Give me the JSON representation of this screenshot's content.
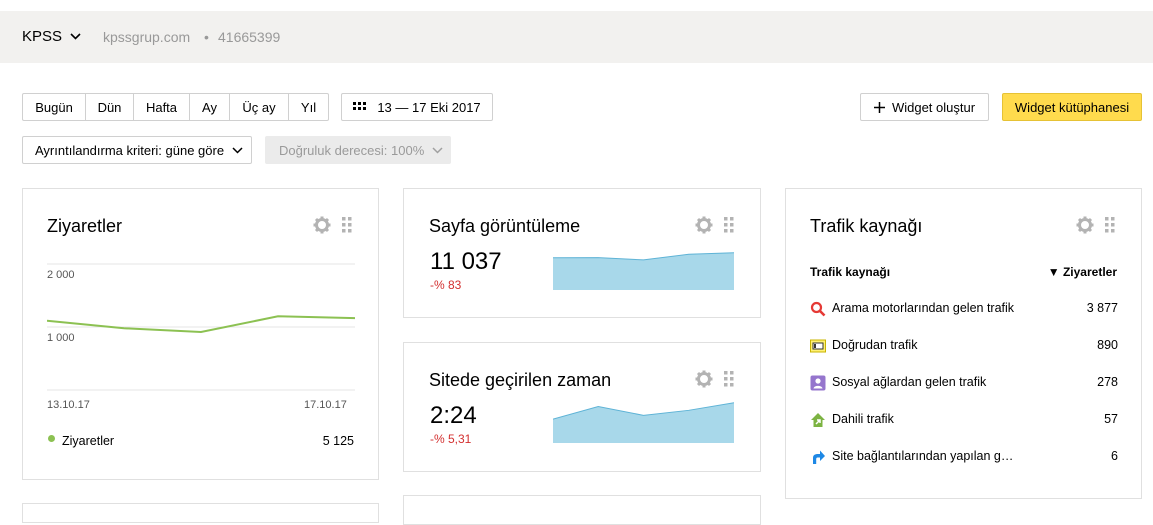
{
  "topbar": {
    "site_name": "KPSS",
    "host": "kpssgrup.com",
    "separator": "•",
    "counter_id": "41665399"
  },
  "period_buttons": [
    "Bugün",
    "Dün",
    "Hafta",
    "Ay",
    "Üç ay",
    "Yıl"
  ],
  "date_range": "13 — 17 Eki 2017",
  "create_widget_label": "Widget oluştur",
  "widget_library_label": "Widget kütüphanesi",
  "detail_select_label": "Ayrıntılandırma kriteri: güne göre",
  "accuracy_select_label": "Doğruluk derecesi: 100%",
  "colors": {
    "accent_yellow": "#ffdb4d",
    "line_green": "#8cc152",
    "area_blue": "#a8d8ea",
    "negative_red": "#d32f2f"
  },
  "visits_widget": {
    "title": "Ziyaretler",
    "y_ticks": [
      "2 000",
      "1 000"
    ],
    "x_ticks": [
      "13.10.17",
      "17.10.17"
    ],
    "legend_label": "Ziyaretler",
    "legend_value": "5 125",
    "chart_data": {
      "type": "line",
      "x": [
        "13.10.17",
        "14.10.17",
        "15.10.17",
        "16.10.17",
        "17.10.17"
      ],
      "series": [
        {
          "name": "Ziyaretler",
          "values": [
            1100,
            980,
            920,
            1170,
            1140
          ]
        }
      ],
      "ylim": [
        0,
        2000
      ]
    }
  },
  "pageviews_widget": {
    "title": "Sayfa görüntüleme",
    "value": "11 037",
    "delta": "-% 83",
    "sparkline": [
      2120,
      2130,
      1980,
      2350,
      2450
    ]
  },
  "time_widget": {
    "title": "Sitede geçirilen zaman",
    "value": "2:24",
    "delta": "-% 5,31",
    "sparkline": [
      138,
      158,
      144,
      152,
      164
    ]
  },
  "traffic_widget": {
    "title": "Trafik kaynağı",
    "col_source": "Trafik kaynağı",
    "col_visits": "▼ Ziyaretler",
    "rows": [
      {
        "icon": "search-icon",
        "label": "Arama motorlarından gelen trafik",
        "value": "3 877"
      },
      {
        "icon": "direct-icon",
        "label": "Doğrudan trafik",
        "value": "890"
      },
      {
        "icon": "social-icon",
        "label": "Sosyal ağlardan gelen trafik",
        "value": "278"
      },
      {
        "icon": "internal-icon",
        "label": "Dahili trafik",
        "value": "57"
      },
      {
        "icon": "link-icon",
        "label": "Site bağlantılarından yapılan g…",
        "value": "6"
      }
    ]
  }
}
